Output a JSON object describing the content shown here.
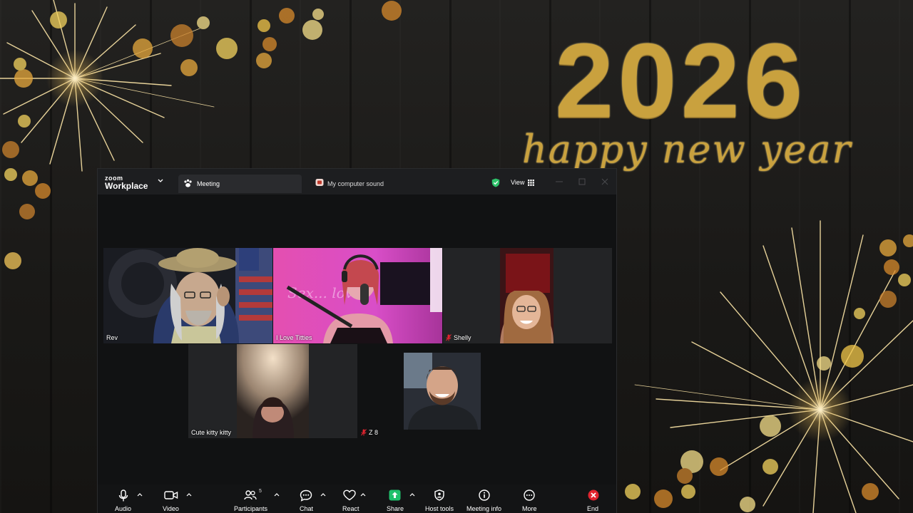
{
  "background": {
    "year": "2026",
    "greeting": "happy new year"
  },
  "app": {
    "brand_top": "zoom",
    "brand_bottom": "Workplace",
    "tab_meeting": "Meeting",
    "tab_sound": "My computer sound",
    "view_label": "View"
  },
  "participants": [
    {
      "name": "Rev",
      "muted": false,
      "active": true
    },
    {
      "name": "I Love Titties",
      "muted": false,
      "active": false
    },
    {
      "name": "Shelly",
      "muted": true,
      "active": false
    },
    {
      "name": "Cute kitty kitty",
      "muted": false,
      "active": false
    },
    {
      "name": "Z 8",
      "muted": true,
      "active": false
    }
  ],
  "toolbar": {
    "audio": "Audio",
    "video": "Video",
    "participants": "Participants",
    "participants_count": "5",
    "chat": "Chat",
    "react": "React",
    "share": "Share",
    "host_tools": "Host tools",
    "meeting_info": "Meeting info",
    "more": "More",
    "end": "End"
  },
  "colors": {
    "active_speaker": "#34d07a",
    "share_green": "#1fc06b",
    "end_red": "#e0242f",
    "gold": "#c9a13e"
  }
}
